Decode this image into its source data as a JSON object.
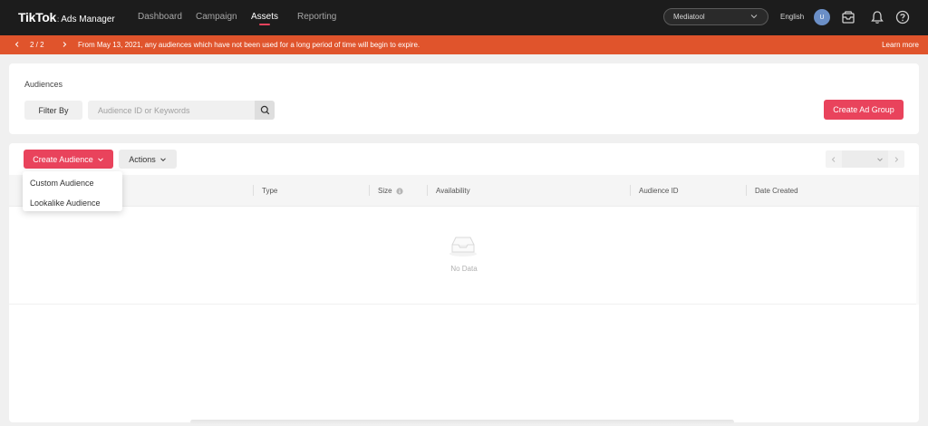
{
  "topbar": {
    "brand": "TikTok",
    "brand_dot": ":",
    "product": "Ads Manager",
    "nav": [
      {
        "label": "Dashboard"
      },
      {
        "label": "Campaign"
      },
      {
        "label": "Assets"
      },
      {
        "label": "Reporting"
      }
    ],
    "active_nav": "Assets",
    "account": "Mediatool",
    "language": "English",
    "avatar_initial": "U",
    "icons": [
      "chevron-down-icon",
      "inbox-icon",
      "bell-icon",
      "help-icon"
    ]
  },
  "banner": {
    "pager": "2 / 2",
    "message": "From May 13, 2021, any audiences which have not been used for a long period of time will begin to expire.",
    "learn_more": "Learn more",
    "color": "#e0542c"
  },
  "audiences_card": {
    "title": "Audiences",
    "filter_label": "Filter By",
    "search_placeholder": "Audience ID or Keywords",
    "create_ad_group": "Create Ad Group"
  },
  "toolbar": {
    "create_audience": "Create Audience",
    "actions": "Actions"
  },
  "dropdown": {
    "items": [
      {
        "label": "Custom Audience"
      },
      {
        "label": "Lookalike Audience"
      }
    ]
  },
  "table": {
    "columns": [
      {
        "label": "Type"
      },
      {
        "label": "Size"
      },
      {
        "label": "Availability"
      },
      {
        "label": "Audience ID"
      },
      {
        "label": "Date Created"
      }
    ],
    "empty_text": "No Data"
  },
  "colors": {
    "accent": "#e9435c",
    "topbar": "#1c1c1c"
  }
}
